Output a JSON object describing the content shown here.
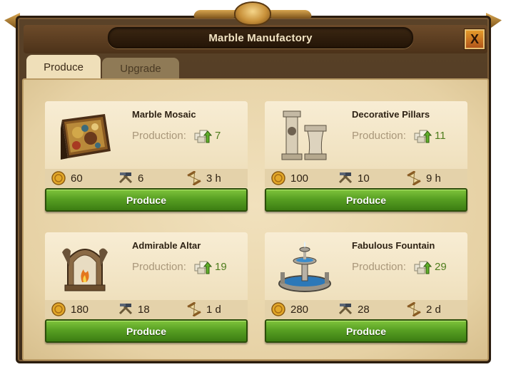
{
  "window": {
    "title": "Marble Manufactory",
    "close_label": "X"
  },
  "tabs": [
    {
      "label": "Produce",
      "active": true
    },
    {
      "label": "Upgrade",
      "active": false
    }
  ],
  "productions": [
    {
      "name": "Marble Mosaic",
      "production_label": "Production:",
      "production_value": "7",
      "coins": "60",
      "supplies": "6",
      "time": "3 h",
      "button": "Produce",
      "image": "marble-mosaic-image"
    },
    {
      "name": "Decorative Pillars",
      "production_label": "Production:",
      "production_value": "11",
      "coins": "100",
      "supplies": "10",
      "time": "9 h",
      "button": "Produce",
      "image": "decorative-pillars-image"
    },
    {
      "name": "Admirable Altar",
      "production_label": "Production:",
      "production_value": "19",
      "coins": "180",
      "supplies": "18",
      "time": "1 d",
      "button": "Produce",
      "image": "admirable-altar-image"
    },
    {
      "name": "Fabulous Fountain",
      "production_label": "Production:",
      "production_value": "29",
      "coins": "280",
      "supplies": "28",
      "time": "2 d",
      "button": "Produce",
      "image": "fabulous-fountain-image"
    }
  ],
  "icons": {
    "coins": "coin-icon",
    "supplies": "hammer-tools-icon",
    "time": "hourglass-icon",
    "production": "marble-goods-icon"
  },
  "colors": {
    "button_green": "#58a023",
    "parchment": "#e6d1a4",
    "frame": "#4c3219",
    "production_value": "#4f7d1e"
  }
}
